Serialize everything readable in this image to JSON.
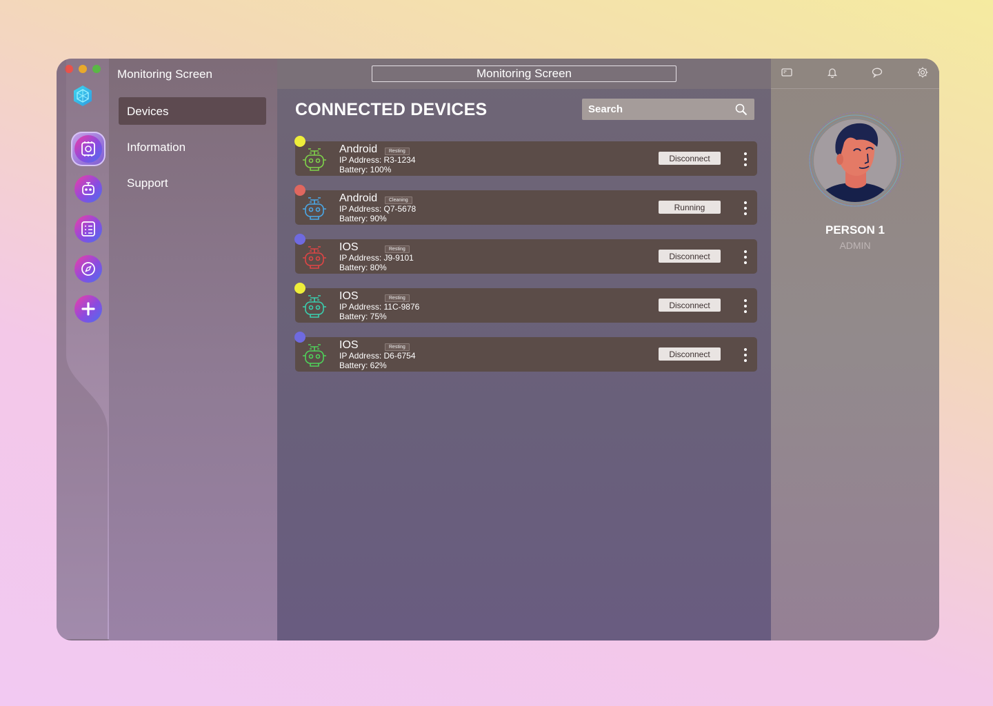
{
  "app": {
    "title": "Monitoring Screen",
    "header_title": "Monitoring Screen"
  },
  "nav": {
    "items": [
      {
        "label": "Devices"
      },
      {
        "label": "Information"
      },
      {
        "label": "Support"
      }
    ]
  },
  "main": {
    "heading": "CONNECTED DEVICES",
    "search_placeholder": "Search"
  },
  "devices": [
    {
      "name": "Android",
      "badge": "Resting",
      "ip": "IP Address: R3-1234",
      "battery": "Battery: 100%",
      "action": "Disconnect",
      "dot_color": "#eeee3a",
      "robot_color": "#7fd44a"
    },
    {
      "name": "Android",
      "badge": "Cleaning",
      "ip": "IP Address: Q7-5678",
      "battery": "Battery: 90%",
      "action": "Running",
      "dot_color": "#e0675f",
      "robot_color": "#4aa8e8"
    },
    {
      "name": "IOS",
      "badge": "Resting",
      "ip": "IP Address: J9-9101",
      "battery": "Battery: 80%",
      "action": "Disconnect",
      "dot_color": "#6f6ae0",
      "robot_color": "#e04545"
    },
    {
      "name": "IOS",
      "badge": "Resting",
      "ip": "IP Address: 11C-9876",
      "battery": "Battery: 75%",
      "action": "Disconnect",
      "dot_color": "#eeee3a",
      "robot_color": "#3ad0b0"
    },
    {
      "name": "IOS",
      "badge": "Resting",
      "ip": "IP Address: D6-6754",
      "battery": "Battery: 62%",
      "action": "Disconnect",
      "dot_color": "#6f6ae0",
      "robot_color": "#4ed45a"
    }
  ],
  "profile": {
    "name": "PERSON 1",
    "role": "ADMIN"
  },
  "icons": {
    "rail": [
      "logo-icon",
      "dashboard-icon",
      "robot-icon",
      "task-list-icon",
      "compass-icon",
      "add-icon"
    ],
    "topbar": [
      "card-icon",
      "bell-icon",
      "chat-icon",
      "settings-icon"
    ]
  },
  "colors": {
    "accent_gradient": [
      "#ee3ea5",
      "#8b4bdf",
      "#4a6ef0"
    ],
    "active_nav": "#5d4a50",
    "device_card": "#5b4c48"
  }
}
